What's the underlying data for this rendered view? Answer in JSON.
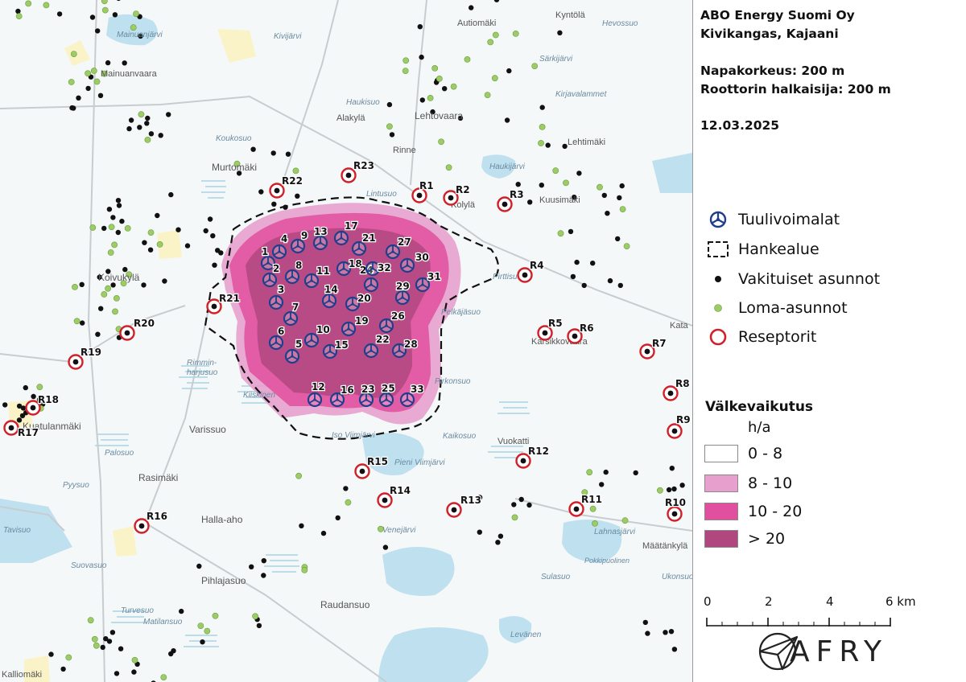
{
  "header": {
    "company": "ABO Energy Suomi Oy",
    "site": "Kivikangas, Kajaani",
    "hub_height": "Napakorkeus: 200 m",
    "rotor_diameter": "Roottorin halkaisija: 200 m",
    "date": "12.03.2025"
  },
  "legend": {
    "turbines": "Tuulivoimalat",
    "project_area": "Hankealue",
    "permanent": "Vakituiset asunnot",
    "holiday": "Loma-asunnot",
    "receptors": "Reseptorit"
  },
  "flicker_legend": {
    "title": "Välkevaikutus",
    "unit": "h/a",
    "classes": [
      {
        "label": "0 - 8",
        "color": "#ffffff"
      },
      {
        "label": "8 - 10",
        "color": "#e7a0cd"
      },
      {
        "label": "10 - 20",
        "color": "#e14f9f"
      },
      {
        "label": "> 20",
        "color": "#b0487f"
      }
    ]
  },
  "scale": {
    "labels": [
      "0",
      "2",
      "4",
      "6 km"
    ]
  },
  "logo": {
    "text": "AFRY"
  },
  "colors": {
    "turbine": "#1f3f8c",
    "receptor": "#d0202a",
    "holiday": "#9ccc65",
    "water": "#bfe0ef",
    "field": "#fbf3c8"
  },
  "map": {
    "place_labels": [
      {
        "id": "autiomaki",
        "text": "Autiomäki"
      },
      {
        "id": "kyntola",
        "text": "Kyntölä"
      },
      {
        "id": "hevossuo",
        "text": "Hevossuo"
      },
      {
        "id": "kivijarvi",
        "text": "Kivijärvi"
      },
      {
        "id": "mainuanjarvi",
        "text": "Mainuanjärvi"
      },
      {
        "id": "mainuanvaara",
        "text": "Mainuanvaara"
      },
      {
        "id": "sarkijarvi",
        "text": "Särkijärvi"
      },
      {
        "id": "kirjavalammet",
        "text": "Kirjavalammet"
      },
      {
        "id": "haukisuo",
        "text": "Haukisuo"
      },
      {
        "id": "alakyla",
        "text": "Alakylä"
      },
      {
        "id": "lehtovaara",
        "text": "Lehtovaara"
      },
      {
        "id": "rinne",
        "text": "Rinne"
      },
      {
        "id": "lehtimaki",
        "text": "Lehtimäki"
      },
      {
        "id": "koukosuo",
        "text": "Koukosuo"
      },
      {
        "id": "murtomaki",
        "text": "Murtomäki"
      },
      {
        "id": "haukijarvi",
        "text": "Haukijärvi"
      },
      {
        "id": "lintusuo",
        "text": "Lintusuo"
      },
      {
        "id": "kolyla",
        "text": "Kolylä"
      },
      {
        "id": "kuusimaki",
        "text": "Kuusimäki"
      },
      {
        "id": "koivukyla",
        "text": "Koivukylä"
      },
      {
        "id": "pirttisuo",
        "text": "Pirttisuo"
      },
      {
        "id": "pelkajasuo",
        "text": "Pelkäjäsuo"
      },
      {
        "id": "karsikkovaara",
        "text": "Karsikkovaara"
      },
      {
        "id": "katajala",
        "text": "Kata"
      },
      {
        "id": "rimminharjusuo1",
        "text": "Rimmin-"
      },
      {
        "id": "rimminharjusuo2",
        "text": "harjusuo"
      },
      {
        "id": "kiiskinen",
        "text": "Kiiskinen"
      },
      {
        "id": "pirkonsuo",
        "text": "Pirkonsuo"
      },
      {
        "id": "varissuo",
        "text": "Varissuo"
      },
      {
        "id": "kaikosuo",
        "text": "Kaikosuo"
      },
      {
        "id": "vuokatti",
        "text": "Vuokatti"
      },
      {
        "id": "isovimijarvi",
        "text": "Iso Viimjärvi"
      },
      {
        "id": "pienivimijarvi",
        "text": "Pieni Viimjärvi"
      },
      {
        "id": "kuatulanmaki",
        "text": "Kuatulanmäki"
      },
      {
        "id": "palosuo",
        "text": "Palosuo"
      },
      {
        "id": "rasimaki",
        "text": "Rasimäki"
      },
      {
        "id": "pyysuo",
        "text": "Pyysuo"
      },
      {
        "id": "hallaaho",
        "text": "Halla-aho"
      },
      {
        "id": "venejarvi",
        "text": "Venejärvi"
      },
      {
        "id": "lahnasjarvi",
        "text": "Lahnasjärvi"
      },
      {
        "id": "maatankyla",
        "text": "Määtänkylä"
      },
      {
        "id": "pokkipuolinen",
        "text": "Pokkipuolinen"
      },
      {
        "id": "sulasuo",
        "text": "Sulasuo"
      },
      {
        "id": "ukonsuo",
        "text": "Ukonsuo"
      },
      {
        "id": "tavisuo",
        "text": "Tavisuo"
      },
      {
        "id": "suovasuo",
        "text": "Suovasuo"
      },
      {
        "id": "pihlajasuo",
        "text": "Pihlajasuo"
      },
      {
        "id": "turvesuo",
        "text": "Turvesuo"
      },
      {
        "id": "raudansuo",
        "text": "Raudansuo"
      },
      {
        "id": "matilansuo",
        "text": "Matilansuo"
      },
      {
        "id": "levanen",
        "text": "Levänen"
      },
      {
        "id": "kallio",
        "text": "Kalliomäki"
      }
    ],
    "turbines": [
      "1",
      "2",
      "3",
      "4",
      "5",
      "6",
      "7",
      "8",
      "9",
      "10",
      "11",
      "12",
      "13",
      "14",
      "15",
      "16",
      "17",
      "18",
      "19",
      "20",
      "21",
      "22",
      "23",
      "24",
      "25",
      "26",
      "27",
      "28",
      "29",
      "30",
      "31",
      "32",
      "33"
    ],
    "receptors": [
      "R1",
      "R2",
      "R3",
      "R4",
      "R5",
      "R6",
      "R7",
      "R8",
      "R9",
      "R10",
      "R11",
      "R12",
      "R13",
      "R14",
      "R15",
      "R16",
      "R17",
      "R18",
      "R19",
      "R20",
      "R21",
      "R22",
      "R23"
    ]
  }
}
